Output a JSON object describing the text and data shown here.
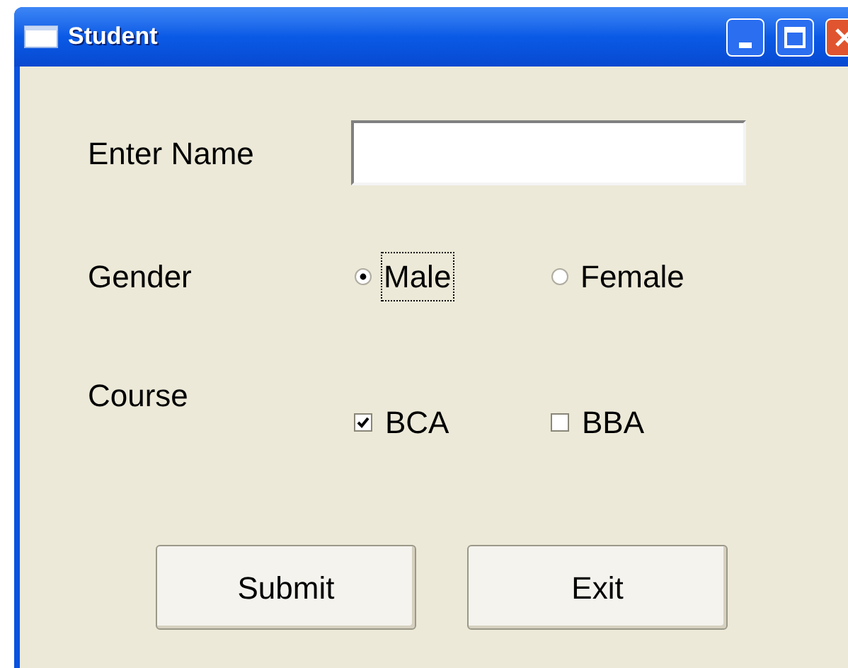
{
  "window": {
    "title": "Student"
  },
  "name_field": {
    "label": "Enter Name"
  },
  "gender": {
    "label": "Gender",
    "options": [
      {
        "label": "Male",
        "selected": true,
        "focused": true
      },
      {
        "label": "Female",
        "selected": false,
        "focused": false
      }
    ]
  },
  "course": {
    "label": "Course",
    "options": [
      {
        "label": "BCA",
        "checked": true
      },
      {
        "label": "BBA",
        "checked": false
      }
    ]
  },
  "buttons": [
    "Submit",
    "Exit"
  ]
}
